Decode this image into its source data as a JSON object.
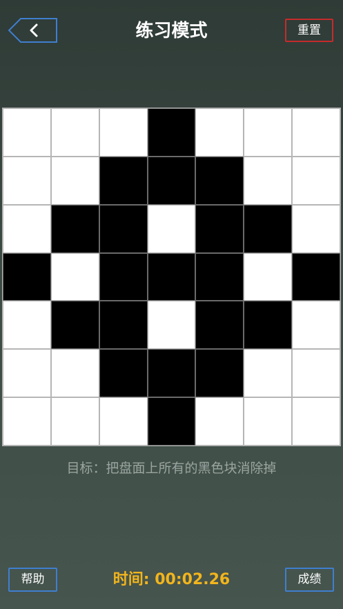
{
  "header": {
    "back_icon": "chevron-left-icon",
    "title": "练习模式",
    "reset_label": "重置"
  },
  "colors": {
    "button_border": "#3f7fd0",
    "reset_border": "#c62b2b",
    "timer": "#f2b51c",
    "goal_text": "#9aa5a0"
  },
  "board": {
    "rows": [
      [
        0,
        0,
        0,
        1,
        0,
        0,
        0
      ],
      [
        0,
        0,
        1,
        1,
        1,
        0,
        0
      ],
      [
        0,
        1,
        1,
        0,
        1,
        1,
        0
      ],
      [
        1,
        0,
        1,
        1,
        1,
        0,
        1
      ],
      [
        0,
        1,
        1,
        0,
        1,
        1,
        0
      ],
      [
        0,
        0,
        1,
        1,
        1,
        0,
        0
      ],
      [
        0,
        0,
        0,
        1,
        0,
        0,
        0
      ]
    ]
  },
  "goal_text": "目标：把盘面上所有的黑色块消除掉",
  "footer": {
    "help_label": "帮助",
    "timer_text": "时间: 00:02.26",
    "score_label": "成绩"
  }
}
